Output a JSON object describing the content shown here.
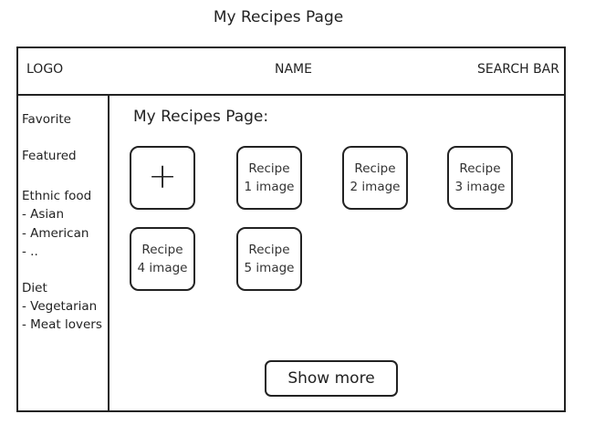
{
  "page": {
    "caption": "My Recipes Page"
  },
  "header": {
    "logo": "LOGO",
    "name": "NAME",
    "search": "SEARCH BAR"
  },
  "sidebar": {
    "items": [
      "Favorite",
      "Featured",
      "Ethnic food",
      "- Asian",
      "- American",
      "- ..",
      "Diet",
      "- Vegetarian",
      "- Meat lovers"
    ]
  },
  "main": {
    "title": "My Recipes Page:",
    "add_icon": "plus-icon",
    "add_symbol": "+",
    "recipes": [
      {
        "line1": "Recipe",
        "line2": "1 image"
      },
      {
        "line1": "Recipe",
        "line2": "2 image"
      },
      {
        "line1": "Recipe",
        "line2": "3 image"
      },
      {
        "line1": "Recipe",
        "line2": "4 image"
      },
      {
        "line1": "Recipe",
        "line2": "5 image"
      }
    ],
    "show_more": "Show more"
  }
}
